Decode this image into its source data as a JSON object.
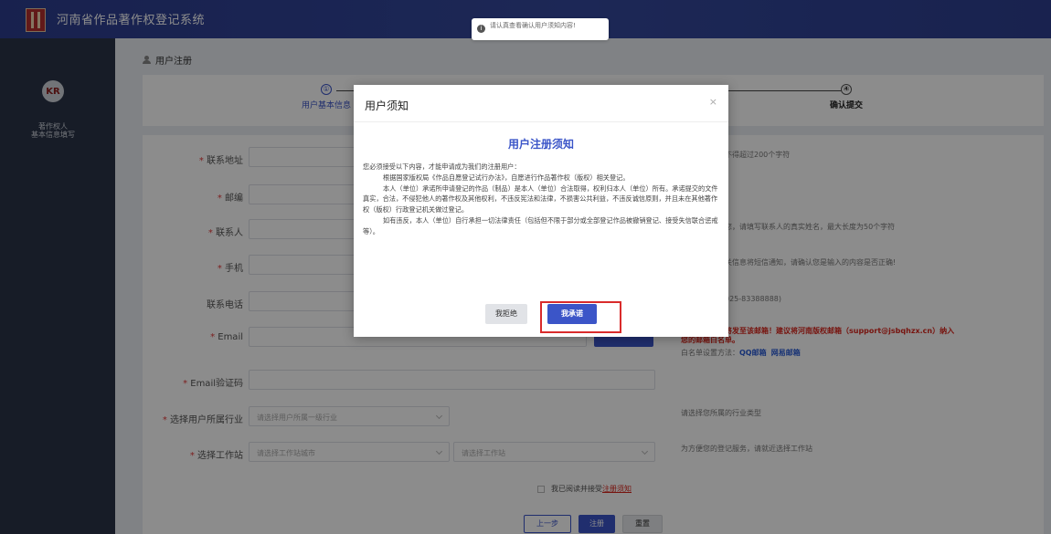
{
  "header": {
    "app_title": "河南省作品著作权登记系统",
    "tip": "请认真查看确认用户须知内容!"
  },
  "sidebar": {
    "avatar_text": "KR",
    "label_line1": "著作权人",
    "label_line2": "基本信息填写"
  },
  "breadcrumb": {
    "label": "用户注册"
  },
  "steps": {
    "step1": {
      "num": "①",
      "label": "用户基本信息"
    },
    "step4": {
      "num": "④",
      "label": "确认提交"
    }
  },
  "form": {
    "address": {
      "label": "联系地址",
      "hint": "的邮寄地址，不得超过200个字符"
    },
    "zipcode": {
      "label": "邮编",
      "hint": "F"
    },
    "contact": {
      "label": "联系人",
      "hint": "人员能联系到您，请填写联系人的真实姓名，最大长度为50个字符"
    },
    "mobile": {
      "label": "手机",
      "hint": "数字，登记相关信息将短信通知，请确认您是输入的内容是否正确!"
    },
    "phone": {
      "label": "联系电话",
      "hint": "机（格式如：025-83388888)"
    },
    "email": {
      "label": "Email",
      "hint_line1": "登记相关信息将发至该邮箱！建议将河南版权邮箱（support@jsbqhzx.cn）纳入",
      "hint_line2": "您的邮箱白名单。",
      "whitelist_prefix": "白名单设置方法：",
      "qq_link": "QQ邮箱",
      "netease_link": "网易邮箱"
    },
    "email_code": {
      "label": "Email验证码"
    },
    "industry": {
      "label": "选择用户所属行业",
      "placeholder": "请选择用户所属一级行业",
      "hint": "请选择您所属的行业类型"
    },
    "station": {
      "label": "选择工作站",
      "city_placeholder": "请选择工作站城市",
      "station_placeholder": "请选择工作站",
      "hint": "为方便您的登记服务，请就近选择工作站"
    },
    "agree_prefix": "我已阅读并接受",
    "agree_link": "注册须知",
    "btn_prev": "上一步",
    "btn_register": "注册",
    "btn_reset": "重置"
  },
  "modal": {
    "title": "用户须知",
    "close": "×",
    "notice_title": "用户注册须知",
    "p1": "您必须接受以下内容，才能申请成为我们的注册用户：",
    "p2": "根据国家版权局《作品自愿登记试行办法》，自愿进行作品著作权（版权）相关登记。",
    "p3": "本人（单位）承诺所申请登记的作品（制品）是本人（单位）合法取得，权利归本人（单位）所有。承诺提交的文件真实，合法，不侵犯他人的著作权及其他权利，不违反宪法和法律，不损害公共利益，不违反诚信原则，并且未在其他著作权（版权）行政登记机关做过登记。",
    "p4": "如有违反，本人（单位）自行承担一切法律责任（包括但不限于部分或全部登记作品被撤销登记、接受失信联合惩戒等）。",
    "btn_reject": "我拒绝",
    "btn_accept": "我承诺"
  }
}
